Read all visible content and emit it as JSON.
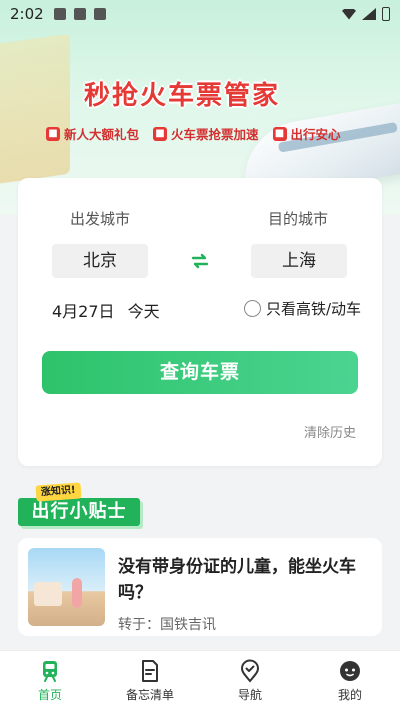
{
  "status_bar": {
    "time": "2:02"
  },
  "banner": {
    "title": "秒抢火车票管家",
    "perks": [
      {
        "icon": "gift-icon",
        "label": "新人大额礼包"
      },
      {
        "icon": "ticket-icon",
        "label": "火车票抢票加速"
      },
      {
        "icon": "safety-icon",
        "label": "出行安心"
      }
    ]
  },
  "search": {
    "from_label": "出发城市",
    "to_label": "目的城市",
    "from_city": "北京",
    "to_city": "上海",
    "date": "4月27日",
    "day": "今天",
    "high_speed_only": "只看高铁/动车",
    "high_speed_checked": false,
    "search_button": "查询车票",
    "clear_history": "清除历史"
  },
  "tips": {
    "tag": "涨知识!",
    "title": "出行小贴士"
  },
  "article": {
    "title": "没有带身份证的儿童，能坐火车吗？",
    "source": "转于：国铁吉讯"
  },
  "tabbar": [
    {
      "label": "首页",
      "icon": "train-icon",
      "active": true
    },
    {
      "label": "备忘清单",
      "icon": "memo-icon",
      "active": false
    },
    {
      "label": "导航",
      "icon": "location-icon",
      "active": false
    },
    {
      "label": "我的",
      "icon": "profile-icon",
      "active": false
    }
  ],
  "colors": {
    "accent": "#22b35a",
    "banner_red": "#e53935"
  }
}
